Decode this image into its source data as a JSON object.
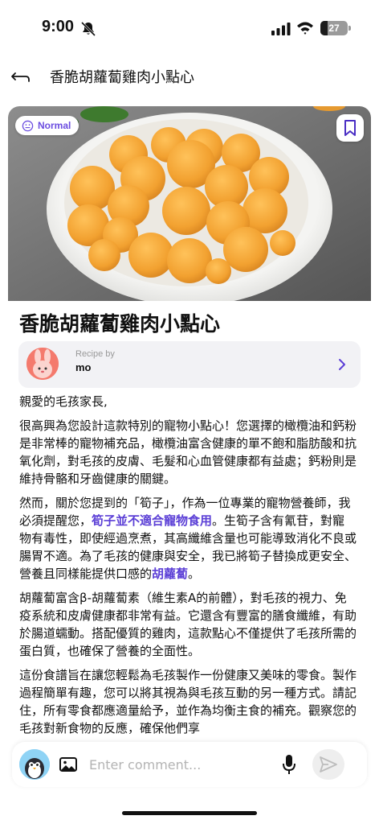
{
  "status_bar": {
    "time": "9:00",
    "battery_level": "27",
    "battery_percent": 27
  },
  "header": {
    "title": "香脆胡蘿蔔雞肉小點心",
    "back_icon": "back-arrow-icon"
  },
  "recipe": {
    "badge_label": "Normal",
    "badge_icon": "neutral-face-icon",
    "bookmark_icon": "bookmark-icon",
    "title": "香脆胡蘿蔔雞肉小點心",
    "author_caption": "Recipe by",
    "author_name": "mo",
    "paragraphs": {
      "p1": "親愛的毛孩家長,",
      "p2": "很高興為您設計這款特別的寵物小點心！您選擇的橄欖油和鈣粉是非常棒的寵物補充品，橄欖油富含健康的單不飽和脂肪酸和抗氧化劑，對毛孩的皮膚、毛髮和心血管健康都有益處；鈣粉則是維持骨骼和牙齒健康的關鍵。",
      "p3_a": "然而，關於您提到的「筍子」，作為一位專業的寵物營養師，我必須提醒您，",
      "p3_hl1": "筍子並不適合寵物食用",
      "p3_b": "。生筍子含有氰苷，對寵物有毒性，即使經過烹煮，其高纖維含量也可能導致消化不良或腸胃不適。為了毛孩的健康與安全，我已將筍子替換成更安全、營養且同樣能提供口感的",
      "p3_hl2": "胡蘿蔔",
      "p3_c": "。",
      "p4": "胡蘿蔔富含β-胡蘿蔔素（維生素A的前體），對毛孩的視力、免疫系統和皮膚健康都非常有益。它還含有豐富的膳食纖維，有助於腸道蠕動。搭配優質的雞肉，這款點心不僅提供了毛孩所需的蛋白質，也確保了營養的全面性。",
      "p5": "這份食譜旨在讓您輕鬆為毛孩製作一份健康又美味的零食。製作過程簡單有趣，您可以將其視為與毛孩互動的另一種方式。請記住，所有零食都應適量給予，並作為均衡主食的補充。觀察您的毛孩對新食物的反應，確保他們享"
    },
    "highlight_color": "#5b3fd6"
  },
  "comment_bar": {
    "placeholder": "Enter comment...",
    "value": "",
    "image_icon": "image-icon",
    "mic_icon": "microphone-icon",
    "send_icon": "send-icon"
  },
  "colors": {
    "accent": "#6b4de0",
    "author_box_bg": "#f2f2f5"
  }
}
